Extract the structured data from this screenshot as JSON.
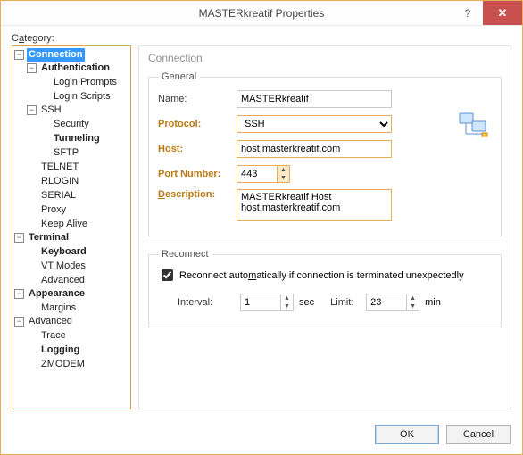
{
  "window": {
    "title": "MASTERkreatif Properties"
  },
  "category_label_pre": "C",
  "category_label_u": "a",
  "category_label_post": "tegory:",
  "tree": {
    "connection": "Connection",
    "authentication": "Authentication",
    "login_prompts": "Login Prompts",
    "login_scripts": "Login Scripts",
    "ssh": "SSH",
    "security": "Security",
    "tunneling": "Tunneling",
    "sftp": "SFTP",
    "telnet": "TELNET",
    "rlogin": "RLOGIN",
    "serial": "SERIAL",
    "proxy": "Proxy",
    "keepalive": "Keep Alive",
    "terminal": "Terminal",
    "keyboard": "Keyboard",
    "vtmodes": "VT Modes",
    "adv": "Advanced",
    "appearance": "Appearance",
    "margins": "Margins",
    "advanced": "Advanced",
    "trace": "Trace",
    "logging": "Logging",
    "zmodem": "ZMODEM"
  },
  "panel": {
    "heading": "Connection",
    "general_legend": "General",
    "name_u": "N",
    "name_rest": "ame:",
    "name_value": "MASTERkreatif",
    "proto_u": "P",
    "proto_rest": "rotocol:",
    "proto_value": "SSH",
    "host_pre": "H",
    "host_u": "o",
    "host_post": "st:",
    "host_value": "host.masterkreatif.com",
    "port_pre": "Po",
    "port_u": "r",
    "port_post": "t Number:",
    "port_value": "443",
    "desc_u": "D",
    "desc_rest": "escription:",
    "desc_value": "MASTERkreatif Host\nhost.masterkreatif.com",
    "reconnect_legend": "Reconnect",
    "reconnect_pre": "Reconnect auto",
    "reconnect_u": "m",
    "reconnect_post": "atically if connection is terminated unexpectedly",
    "interval_pre": "Interv",
    "interval_u": "a",
    "interval_post": "l:",
    "interval_value": "1",
    "sec": "sec",
    "limit_pre": "L",
    "limit_u": "i",
    "limit_post": "mit:",
    "limit_value": "23",
    "min": "min"
  },
  "buttons": {
    "ok": "OK",
    "cancel": "Cancel"
  }
}
